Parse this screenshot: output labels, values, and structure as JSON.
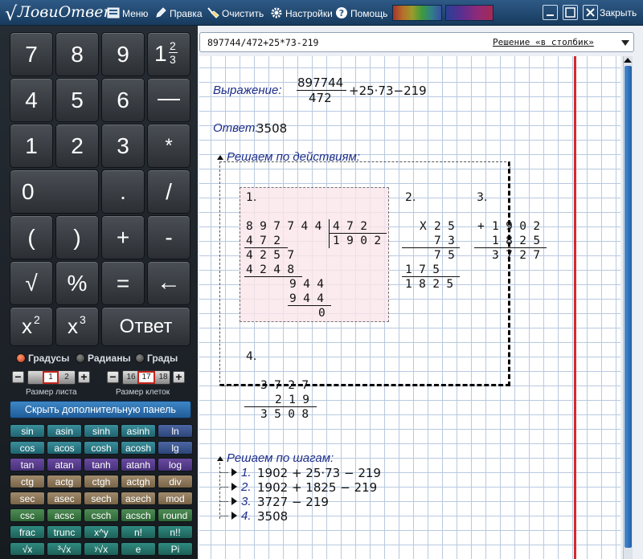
{
  "app": {
    "logo_text": "ЛовиОтвет"
  },
  "toolbar": {
    "menu_label": "Меню",
    "edit_label": "Правка",
    "clear_label": "Очистить",
    "settings_label": "Настройки",
    "help_label": "Помощь",
    "close_label": "Закрыть"
  },
  "keypad": {
    "row1": [
      "7",
      "8",
      "9",
      "1",
      "2",
      "3"
    ],
    "row1_minus": "—",
    "row2": [
      "4",
      "5",
      "6"
    ],
    "row3": [
      "1",
      "2",
      "3",
      "*"
    ],
    "row4": [
      "0",
      ".",
      "/"
    ],
    "row5": [
      "(",
      ")",
      "+",
      "-"
    ],
    "row6": [
      "√",
      "%",
      "=",
      "←"
    ],
    "x_label": "x",
    "sq": "2",
    "cube": "3",
    "answer_label": "Ответ"
  },
  "angle_modes": {
    "degrees": "Градусы",
    "radians": "Радианы",
    "grads": "Грады",
    "selected": "degrees"
  },
  "sheet_size": {
    "label": "Размер листа",
    "values": [
      "1",
      "2"
    ],
    "selected": "1"
  },
  "cell_size": {
    "label": "Размер клеток",
    "values": [
      "16",
      "17",
      "18"
    ],
    "selected": "17"
  },
  "hide_panel_label": "Скрыть дополнительную панель",
  "functions": [
    [
      "sin",
      "asin",
      "sinh",
      "asinh",
      "ln"
    ],
    [
      "cos",
      "acos",
      "cosh",
      "acosh",
      "lg"
    ],
    [
      "tan",
      "atan",
      "tanh",
      "atanh",
      "log"
    ],
    [
      "ctg",
      "actg",
      "ctgh",
      "actgh",
      "div"
    ],
    [
      "sec",
      "asec",
      "sech",
      "asech",
      "mod"
    ],
    [
      "csc",
      "acsc",
      "csch",
      "acsch",
      "round"
    ],
    [
      "frac",
      "trunc",
      "x^y",
      "n!",
      "n!!"
    ],
    [
      "√x",
      "³√x",
      "ʸ√x",
      "e",
      "Pi"
    ]
  ],
  "input": {
    "expression": "897744/472+25*73-219",
    "mode": "Решение «в столбик»"
  },
  "solution": {
    "expression_label": "Выражение:",
    "numerator": "897744",
    "denominator": "472",
    "expression_rest": "+25·73−219",
    "answer_label": "Ответ:",
    "answer": "3508",
    "by_actions_label": "Решаем по действиям:",
    "step_numbers": [
      "1.",
      "2.",
      "3.",
      "4."
    ],
    "division": {
      "dividend": "897744",
      "divisor": "472",
      "quotient": "1902",
      "lines": [
        "472",
        "4257",
        "4248",
        "944",
        "944",
        "0"
      ]
    },
    "multiplication": {
      "op": "X",
      "a": "25",
      "b": "73",
      "p1": "75",
      "p2": "175",
      "result": "1825"
    },
    "addition": {
      "op": "+",
      "a": "1902",
      "b": "1825",
      "result": "3727"
    },
    "subtraction": {
      "op": "-",
      "a": "3727",
      "b": "219",
      "result": "3508"
    },
    "by_steps_label": "Решаем по шагам:",
    "steps": [
      {
        "n": "1.",
        "text": "1902 + 25·73 − 219"
      },
      {
        "n": "2.",
        "text": "1902 + 1825 − 219"
      },
      {
        "n": "3.",
        "text": "3727 − 219"
      },
      {
        "n": "4.",
        "text": "3508"
      }
    ]
  }
}
